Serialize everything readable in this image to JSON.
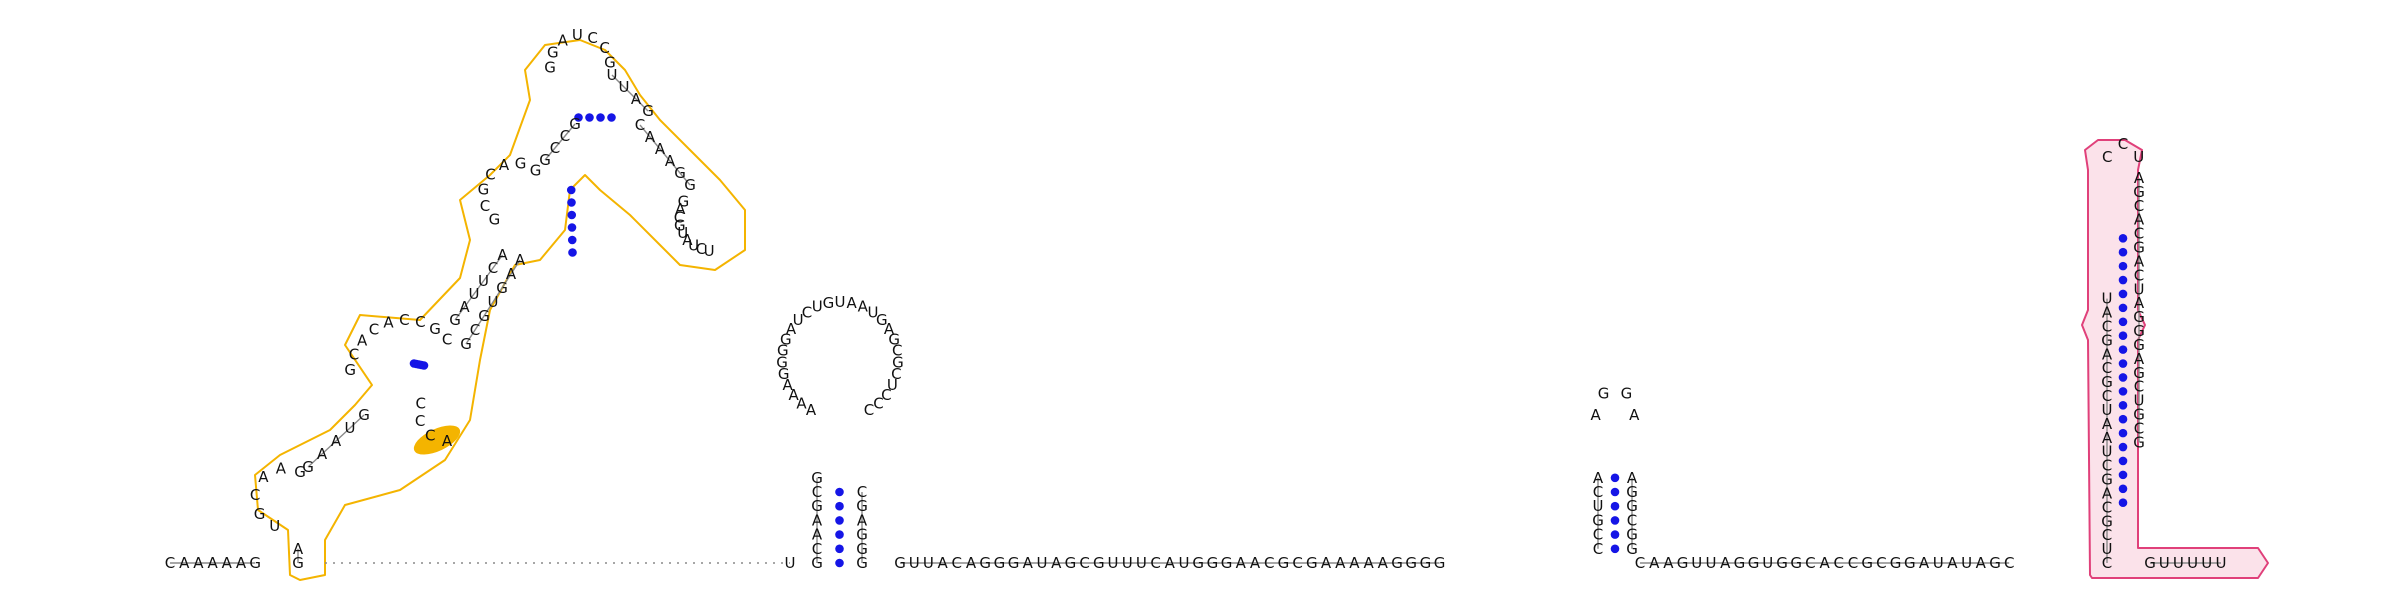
{
  "diagram": {
    "type": "rna-secondary-structure",
    "colors": {
      "background": "#ffffff",
      "nucleotide_text": "#111111",
      "backbone": "#8a8a8a",
      "base_pair": "#1515e6",
      "highlight_orange": "#f4b400",
      "highlight_pink_stroke": "#e0407a",
      "highlight_pink_fill": "#fbe2ea"
    },
    "sequences": {
      "five_prime": "CAAAAAG",
      "left_domain": "GAUGCAAGGAAUGGCACACCGCGAUUCAGCGCAGGGCCGGGAUCCGUUAGGACGUAUCUGGAAACAAGUGCGACCC",
      "gap_note": "",
      "hp1_5prime": "UGCAAGCG",
      "hp1_loop": "AAAAGGGGAUCUGUAAUGAGCGCUCCC",
      "hp1_3prime": "GGGAGC",
      "linker1": "GUUACAGGGAUAGCGUUUCAUGGGAACGCGAAAAAGGGG",
      "hp2": "CCGUCAAGGAAGGCGG",
      "linker2": "CAAGUUAGGUGGCACCGCGGAUAUAGC",
      "terminator": "CUCGCAGCUAAUCGCAGCAUCCUAGCACGACUAGGGAGCUGCG",
      "three_prime": "GUUUUU"
    }
  }
}
